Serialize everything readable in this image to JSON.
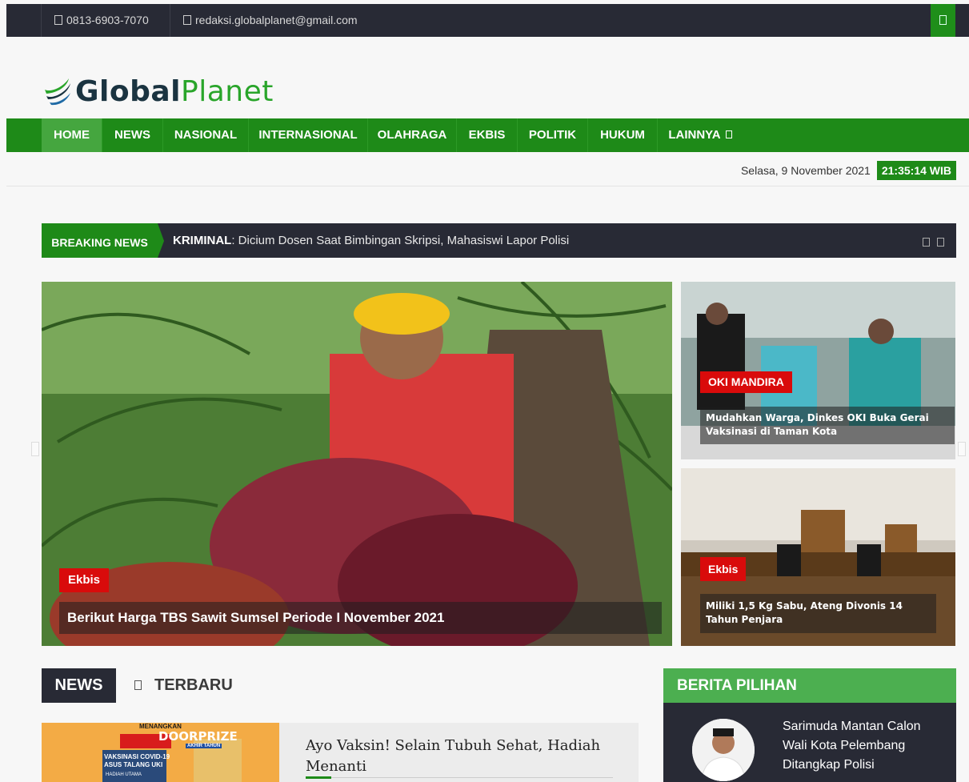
{
  "topbar": {
    "phone": "0813-6903-7070",
    "email": "redaksi.globalplanet@gmail.com",
    "phone_icon": "phone-icon",
    "email_icon": "envelope-icon",
    "search_icon": "search-icon"
  },
  "logo": {
    "part1": "Global",
    "part2": "Planet"
  },
  "nav": {
    "items": [
      "HOME",
      "NEWS",
      "NASIONAL",
      "INTERNASIONAL",
      "OLAHRAGA",
      "EKBIS",
      "POLITIK",
      "HUKUM",
      "LAINNYA"
    ],
    "active": "HOME"
  },
  "datebar": {
    "date": "Selasa, 9 November 2021",
    "time": "21:35:14 WIB"
  },
  "breaking": {
    "label": "BREAKING NEWS",
    "category": "KRIMINAL",
    "headline": ": Dicium Dosen Saat Bimbingan Skripsi, Mahasiswi Lapor Polisi"
  },
  "hero": {
    "category": "Ekbis",
    "title": "Berikut Harga TBS Sawit Sumsel Periode I November 2021"
  },
  "side_posts": [
    {
      "category": "OKI MANDIRA",
      "title": "Mudahkan Warga, Dinkes OKI Buka Gerai Vaksinasi di Taman Kota"
    },
    {
      "category": "Ekbis",
      "title": "Miliki 1,5 Kg Sabu, Ateng Divonis 14 Tahun Penjara"
    }
  ],
  "news_section": {
    "tab": "NEWS",
    "subtab": "TERBARU",
    "post_title": "Ayo Vaksin! Selain Tubuh Sehat, Hadiah Menanti",
    "thumb_lines": [
      "MENANGKAN",
      "DOORPRIZE",
      "AKHIR TAHUN",
      "VAKSINASI COVID-19",
      "ASUS TALANG UKI",
      "HADIAH UTAMA"
    ]
  },
  "pilihan": {
    "heading": "BERITA PILIHAN",
    "title": "Sarimuda Mantan Calon Wali Kota Pelembang Ditangkap Polisi"
  },
  "colors": {
    "green": "#1e8a18",
    "dark": "#282a35",
    "red": "#d90b0b",
    "light_green": "#4caf50"
  }
}
